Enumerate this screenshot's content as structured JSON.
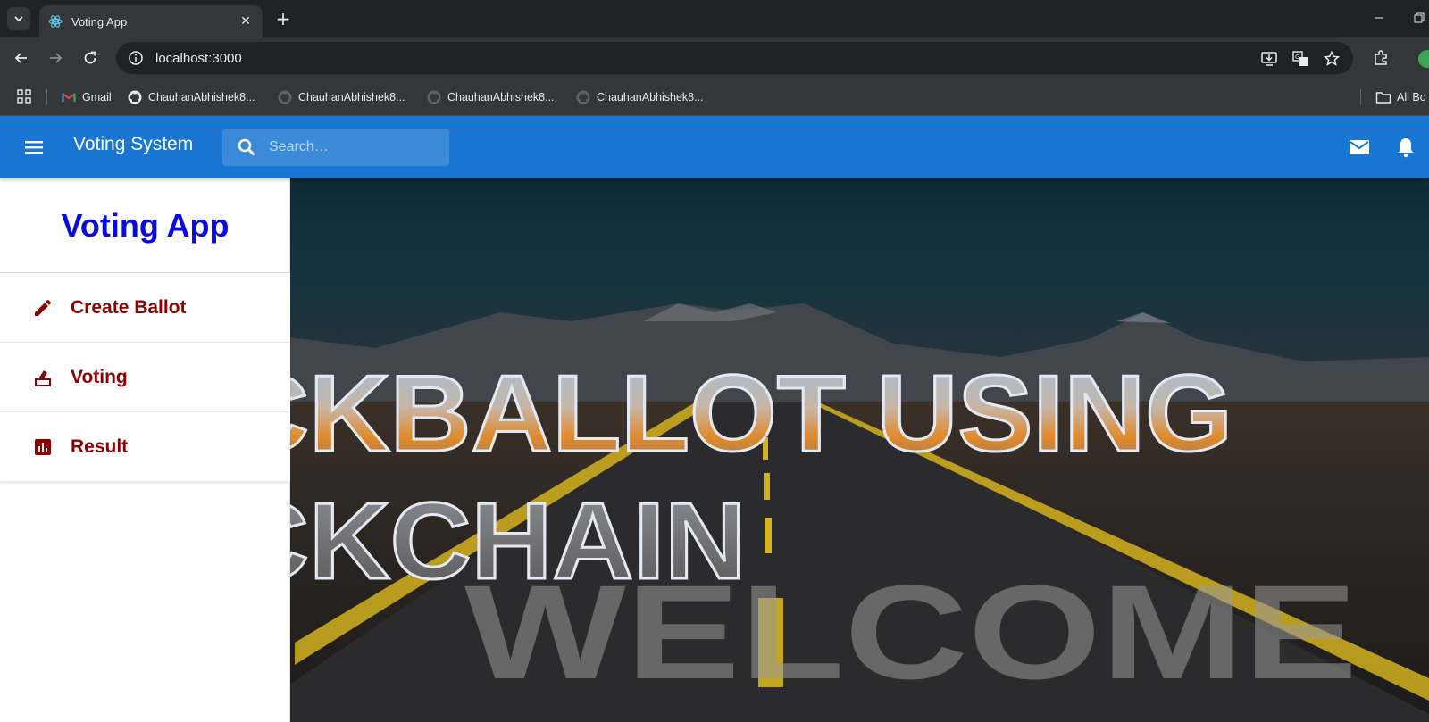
{
  "browser": {
    "tab_title": "Voting App",
    "url": "localhost:3000",
    "bookmarks": [
      {
        "label": "Gmail"
      },
      {
        "label": "ChauhanAbhishek8..."
      },
      {
        "label": "ChauhanAbhishek8..."
      },
      {
        "label": "ChauhanAbhishek8..."
      },
      {
        "label": "ChauhanAbhishek8..."
      }
    ],
    "all_bookmarks_label": "All Bo"
  },
  "appbar": {
    "title": "Voting System",
    "search_placeholder": "Search…",
    "color": "#1976d2"
  },
  "sidebar": {
    "title": "Voting App",
    "title_color": "#0a0ae0",
    "items": [
      {
        "label": "Create Ballot",
        "icon": "pencil-icon"
      },
      {
        "label": "Voting",
        "icon": "ballot-box-icon"
      },
      {
        "label": "Result",
        "icon": "bar-chart-icon"
      }
    ],
    "item_color": "#8b0000"
  },
  "hero": {
    "headline_line1": "CKBALLOT USING",
    "headline_line2": "CKCHAIN",
    "road_text": "WELCOME"
  }
}
